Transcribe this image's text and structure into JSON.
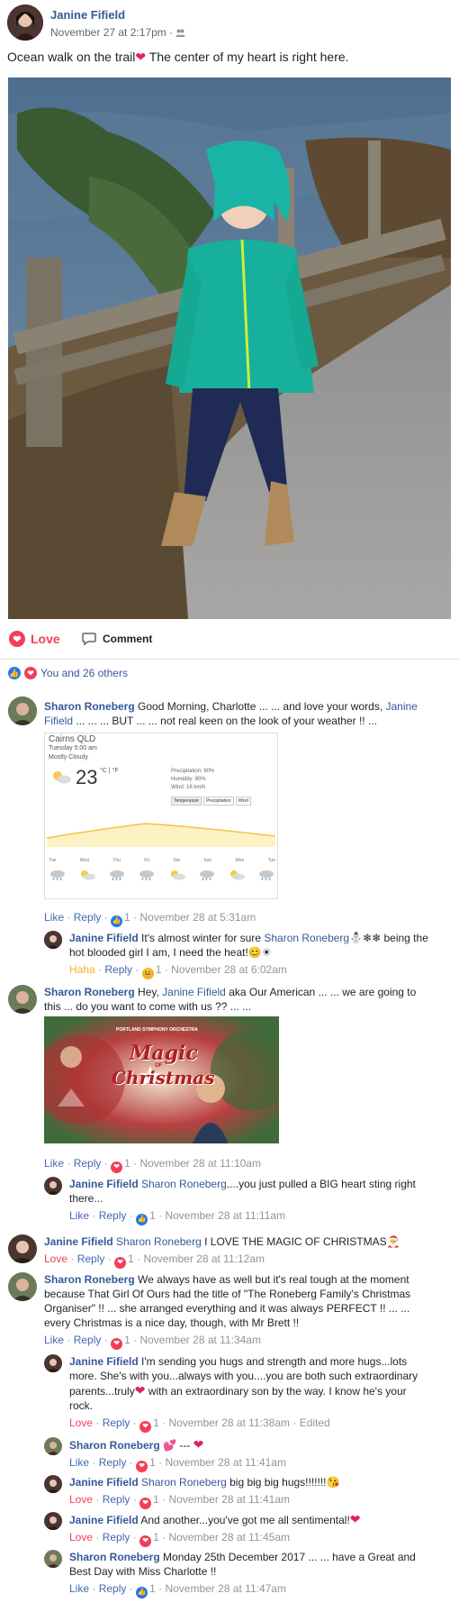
{
  "post": {
    "author": "Janine Fifield",
    "timestamp": "November 27 at 2:17pm",
    "text_a": "Ocean walk on the trail",
    "text_b": " The center of my heart is right here."
  },
  "actions": {
    "love": "Love",
    "comment": "Comment"
  },
  "reactions_summary": "You and 26 others",
  "weather": {
    "location": "Cairns QLD",
    "time": "Tuesday 5:00 am",
    "condition": "Mostly Cloudy",
    "temp": "23",
    "units": "°C | °F",
    "precip": "Precipitation: 60%",
    "humidity": "Humidity: 90%",
    "wind": "Wind: 16 km/h",
    "tabs": [
      "Temperature",
      "Precipitation",
      "Wind"
    ],
    "days": [
      "Tue",
      "Wed",
      "Thu",
      "Fri",
      "Sat",
      "Sun",
      "Mon",
      "Tue"
    ]
  },
  "magic": {
    "title1": "Magic",
    "of": "OF",
    "title2": "Christmas",
    "org": "PORTLAND SYMPHONY ORCHESTRA"
  },
  "comments": [
    {
      "name": "Sharon Roneberg",
      "text_a": " Good Morning, Charlotte ... ... and love your words, ",
      "mention": "Janine Fifield",
      "text_b": " ... ... ... BUT ... ... not real keen on the look of your weather !! ...",
      "reaction_label": "Like",
      "reply": "Reply",
      "count": "1",
      "time": "November 28 at 5:31am"
    },
    {
      "name": "Janine Fifield",
      "text_a": " It's almost winter for sure ",
      "mention": "Sharon Roneberg",
      "text_b": " being the hot blooded girl I am, I need the heat!",
      "reaction_label": "Haha",
      "reply": "Reply",
      "count": "1",
      "time": "November 28 at 6:02am"
    },
    {
      "name": "Sharon Roneberg",
      "text_a": " Hey, ",
      "mention": "Janine Fifield",
      "text_b": " aka Our American ... ... we are going to this ... do you want to come with us ?? ... ...",
      "reaction_label": "Like",
      "reply": "Reply",
      "count": "1",
      "time": "November 28 at 11:10am"
    },
    {
      "name": "Janine Fifield",
      "mention": "Sharon Roneberg",
      "text_b": "....you just pulled a BIG heart sting right there...",
      "reaction_label": "Like",
      "reply": "Reply",
      "count": "1",
      "time": "November 28 at 11:11am"
    },
    {
      "name": "Janine Fifield",
      "mention": "Sharon Roneberg",
      "text_b": " I LOVE THE MAGIC OF CHRISTMAS",
      "reaction_label": "Love",
      "reply": "Reply",
      "count": "1",
      "time": "November 28 at 11:12am"
    },
    {
      "name": "Sharon Roneberg",
      "text_a": " We always have as well but it's real tough at the moment because That Girl Of Ours had the title of \"The Roneberg Family's Christmas Organiser\" !! ... she arranged everything and it was always PERFECT !! ... ... every Christmas is a nice day, though, with Mr Brett !!",
      "reaction_label": "Like",
      "reply": "Reply",
      "count": "1",
      "time": "November 28 at 11:34am"
    },
    {
      "name": "Janine Fifield",
      "text_a": " I'm sending you hugs and strength and more hugs...lots more. She's with you...always with you....you are both such extraordinary parents...truly",
      "text_b": " with an extraordinary son by the way. I know he's your rock.",
      "reaction_label": "Love",
      "reply": "Reply",
      "count": "1",
      "time": "November 28 at 11:38am",
      "edited": "Edited"
    },
    {
      "name": "Sharon Roneberg",
      "text_a": " --- ",
      "reaction_label": "Like",
      "reply": "Reply",
      "count": "1",
      "time": "November 28 at 11:41am"
    },
    {
      "name": "Janine Fifield",
      "mention": "Sharon Roneberg",
      "text_b": " big big big hugs!!!!!!!",
      "reaction_label": "Love",
      "reply": "Reply",
      "count": "1",
      "time": "November 28 at 11:41am"
    },
    {
      "name": "Janine Fifield",
      "text_a": " And another...you've got me all sentimental!",
      "reaction_label": "Love",
      "reply": "Reply",
      "count": "1",
      "time": "November 28 at 11:45am"
    },
    {
      "name": "Sharon Roneberg",
      "text_a": " Monday 25th December 2017 ... ... have a Great and Best Day with Miss Charlotte !!",
      "reaction_label": "Like",
      "reply": "Reply",
      "count": "1",
      "time": "November 28 at 11:47am"
    }
  ],
  "dot": "·",
  "colors": {
    "link": "#365899",
    "love": "#f33e58",
    "like": "#2078f4",
    "muted": "#90949c"
  }
}
